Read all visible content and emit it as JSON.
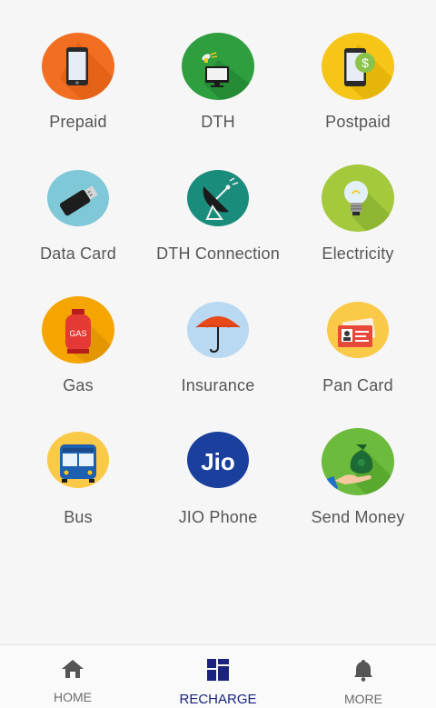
{
  "tiles": [
    {
      "label": "Prepaid",
      "icon": "mobile-phone-icon",
      "color": "#f26f21"
    },
    {
      "label": "DTH",
      "icon": "satellite-tv-icon",
      "color": "#2e9e3f"
    },
    {
      "label": "Postpaid",
      "icon": "phone-bill-icon",
      "color": "#f5c518"
    },
    {
      "label": "Data Card",
      "icon": "usb-dongle-icon",
      "color": "#7ec8d8"
    },
    {
      "label": "DTH Connection",
      "icon": "satellite-dish-icon",
      "color": "#1a8c7c"
    },
    {
      "label": "Electricity",
      "icon": "light-bulb-icon",
      "color": "#a5c93d"
    },
    {
      "label": "Gas",
      "icon": "gas-cylinder-icon",
      "color": "#f5a500"
    },
    {
      "label": "Insurance",
      "icon": "umbrella-icon",
      "color": "#b9d8f2"
    },
    {
      "label": "Pan Card",
      "icon": "id-card-icon",
      "color": "#fbc948"
    },
    {
      "label": "Bus",
      "icon": "bus-icon",
      "color": "#fbc948"
    },
    {
      "label": "JIO Phone",
      "icon": "jio-logo-icon",
      "color": "#1a3f9c"
    },
    {
      "label": "Send Money",
      "icon": "money-bag-icon",
      "color": "#6cbb3c"
    }
  ],
  "jio_logo_text": "Jio",
  "gas_text": "GAS",
  "nav": {
    "items": [
      {
        "label": "HOME",
        "icon": "home-icon"
      },
      {
        "label": "RECHARGE",
        "icon": "grid-icon",
        "active": true
      },
      {
        "label": "MORE",
        "icon": "bell-icon"
      }
    ],
    "active_color": "#1a237e"
  }
}
